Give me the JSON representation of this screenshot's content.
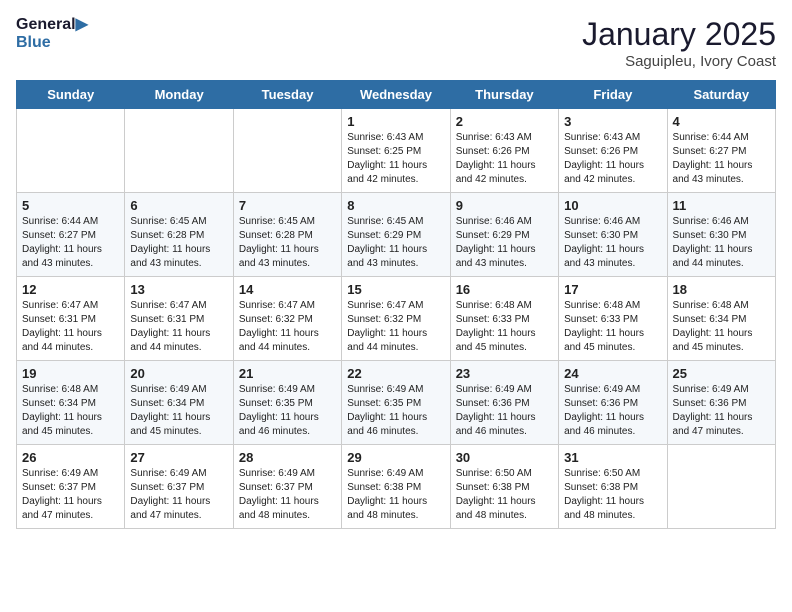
{
  "header": {
    "logo_general": "General",
    "logo_blue": "Blue",
    "title": "January 2025",
    "subtitle": "Saguipleu, Ivory Coast"
  },
  "days_of_week": [
    "Sunday",
    "Monday",
    "Tuesday",
    "Wednesday",
    "Thursday",
    "Friday",
    "Saturday"
  ],
  "weeks": [
    [
      {
        "day": "",
        "sunrise": "",
        "sunset": "",
        "daylight": ""
      },
      {
        "day": "",
        "sunrise": "",
        "sunset": "",
        "daylight": ""
      },
      {
        "day": "",
        "sunrise": "",
        "sunset": "",
        "daylight": ""
      },
      {
        "day": "1",
        "sunrise": "Sunrise: 6:43 AM",
        "sunset": "Sunset: 6:25 PM",
        "daylight": "Daylight: 11 hours and 42 minutes."
      },
      {
        "day": "2",
        "sunrise": "Sunrise: 6:43 AM",
        "sunset": "Sunset: 6:26 PM",
        "daylight": "Daylight: 11 hours and 42 minutes."
      },
      {
        "day": "3",
        "sunrise": "Sunrise: 6:43 AM",
        "sunset": "Sunset: 6:26 PM",
        "daylight": "Daylight: 11 hours and 42 minutes."
      },
      {
        "day": "4",
        "sunrise": "Sunrise: 6:44 AM",
        "sunset": "Sunset: 6:27 PM",
        "daylight": "Daylight: 11 hours and 43 minutes."
      }
    ],
    [
      {
        "day": "5",
        "sunrise": "Sunrise: 6:44 AM",
        "sunset": "Sunset: 6:27 PM",
        "daylight": "Daylight: 11 hours and 43 minutes."
      },
      {
        "day": "6",
        "sunrise": "Sunrise: 6:45 AM",
        "sunset": "Sunset: 6:28 PM",
        "daylight": "Daylight: 11 hours and 43 minutes."
      },
      {
        "day": "7",
        "sunrise": "Sunrise: 6:45 AM",
        "sunset": "Sunset: 6:28 PM",
        "daylight": "Daylight: 11 hours and 43 minutes."
      },
      {
        "day": "8",
        "sunrise": "Sunrise: 6:45 AM",
        "sunset": "Sunset: 6:29 PM",
        "daylight": "Daylight: 11 hours and 43 minutes."
      },
      {
        "day": "9",
        "sunrise": "Sunrise: 6:46 AM",
        "sunset": "Sunset: 6:29 PM",
        "daylight": "Daylight: 11 hours and 43 minutes."
      },
      {
        "day": "10",
        "sunrise": "Sunrise: 6:46 AM",
        "sunset": "Sunset: 6:30 PM",
        "daylight": "Daylight: 11 hours and 43 minutes."
      },
      {
        "day": "11",
        "sunrise": "Sunrise: 6:46 AM",
        "sunset": "Sunset: 6:30 PM",
        "daylight": "Daylight: 11 hours and 44 minutes."
      }
    ],
    [
      {
        "day": "12",
        "sunrise": "Sunrise: 6:47 AM",
        "sunset": "Sunset: 6:31 PM",
        "daylight": "Daylight: 11 hours and 44 minutes."
      },
      {
        "day": "13",
        "sunrise": "Sunrise: 6:47 AM",
        "sunset": "Sunset: 6:31 PM",
        "daylight": "Daylight: 11 hours and 44 minutes."
      },
      {
        "day": "14",
        "sunrise": "Sunrise: 6:47 AM",
        "sunset": "Sunset: 6:32 PM",
        "daylight": "Daylight: 11 hours and 44 minutes."
      },
      {
        "day": "15",
        "sunrise": "Sunrise: 6:47 AM",
        "sunset": "Sunset: 6:32 PM",
        "daylight": "Daylight: 11 hours and 44 minutes."
      },
      {
        "day": "16",
        "sunrise": "Sunrise: 6:48 AM",
        "sunset": "Sunset: 6:33 PM",
        "daylight": "Daylight: 11 hours and 45 minutes."
      },
      {
        "day": "17",
        "sunrise": "Sunrise: 6:48 AM",
        "sunset": "Sunset: 6:33 PM",
        "daylight": "Daylight: 11 hours and 45 minutes."
      },
      {
        "day": "18",
        "sunrise": "Sunrise: 6:48 AM",
        "sunset": "Sunset: 6:34 PM",
        "daylight": "Daylight: 11 hours and 45 minutes."
      }
    ],
    [
      {
        "day": "19",
        "sunrise": "Sunrise: 6:48 AM",
        "sunset": "Sunset: 6:34 PM",
        "daylight": "Daylight: 11 hours and 45 minutes."
      },
      {
        "day": "20",
        "sunrise": "Sunrise: 6:49 AM",
        "sunset": "Sunset: 6:34 PM",
        "daylight": "Daylight: 11 hours and 45 minutes."
      },
      {
        "day": "21",
        "sunrise": "Sunrise: 6:49 AM",
        "sunset": "Sunset: 6:35 PM",
        "daylight": "Daylight: 11 hours and 46 minutes."
      },
      {
        "day": "22",
        "sunrise": "Sunrise: 6:49 AM",
        "sunset": "Sunset: 6:35 PM",
        "daylight": "Daylight: 11 hours and 46 minutes."
      },
      {
        "day": "23",
        "sunrise": "Sunrise: 6:49 AM",
        "sunset": "Sunset: 6:36 PM",
        "daylight": "Daylight: 11 hours and 46 minutes."
      },
      {
        "day": "24",
        "sunrise": "Sunrise: 6:49 AM",
        "sunset": "Sunset: 6:36 PM",
        "daylight": "Daylight: 11 hours and 46 minutes."
      },
      {
        "day": "25",
        "sunrise": "Sunrise: 6:49 AM",
        "sunset": "Sunset: 6:36 PM",
        "daylight": "Daylight: 11 hours and 47 minutes."
      }
    ],
    [
      {
        "day": "26",
        "sunrise": "Sunrise: 6:49 AM",
        "sunset": "Sunset: 6:37 PM",
        "daylight": "Daylight: 11 hours and 47 minutes."
      },
      {
        "day": "27",
        "sunrise": "Sunrise: 6:49 AM",
        "sunset": "Sunset: 6:37 PM",
        "daylight": "Daylight: 11 hours and 47 minutes."
      },
      {
        "day": "28",
        "sunrise": "Sunrise: 6:49 AM",
        "sunset": "Sunset: 6:37 PM",
        "daylight": "Daylight: 11 hours and 48 minutes."
      },
      {
        "day": "29",
        "sunrise": "Sunrise: 6:49 AM",
        "sunset": "Sunset: 6:38 PM",
        "daylight": "Daylight: 11 hours and 48 minutes."
      },
      {
        "day": "30",
        "sunrise": "Sunrise: 6:50 AM",
        "sunset": "Sunset: 6:38 PM",
        "daylight": "Daylight: 11 hours and 48 minutes."
      },
      {
        "day": "31",
        "sunrise": "Sunrise: 6:50 AM",
        "sunset": "Sunset: 6:38 PM",
        "daylight": "Daylight: 11 hours and 48 minutes."
      },
      {
        "day": "",
        "sunrise": "",
        "sunset": "",
        "daylight": ""
      }
    ]
  ]
}
